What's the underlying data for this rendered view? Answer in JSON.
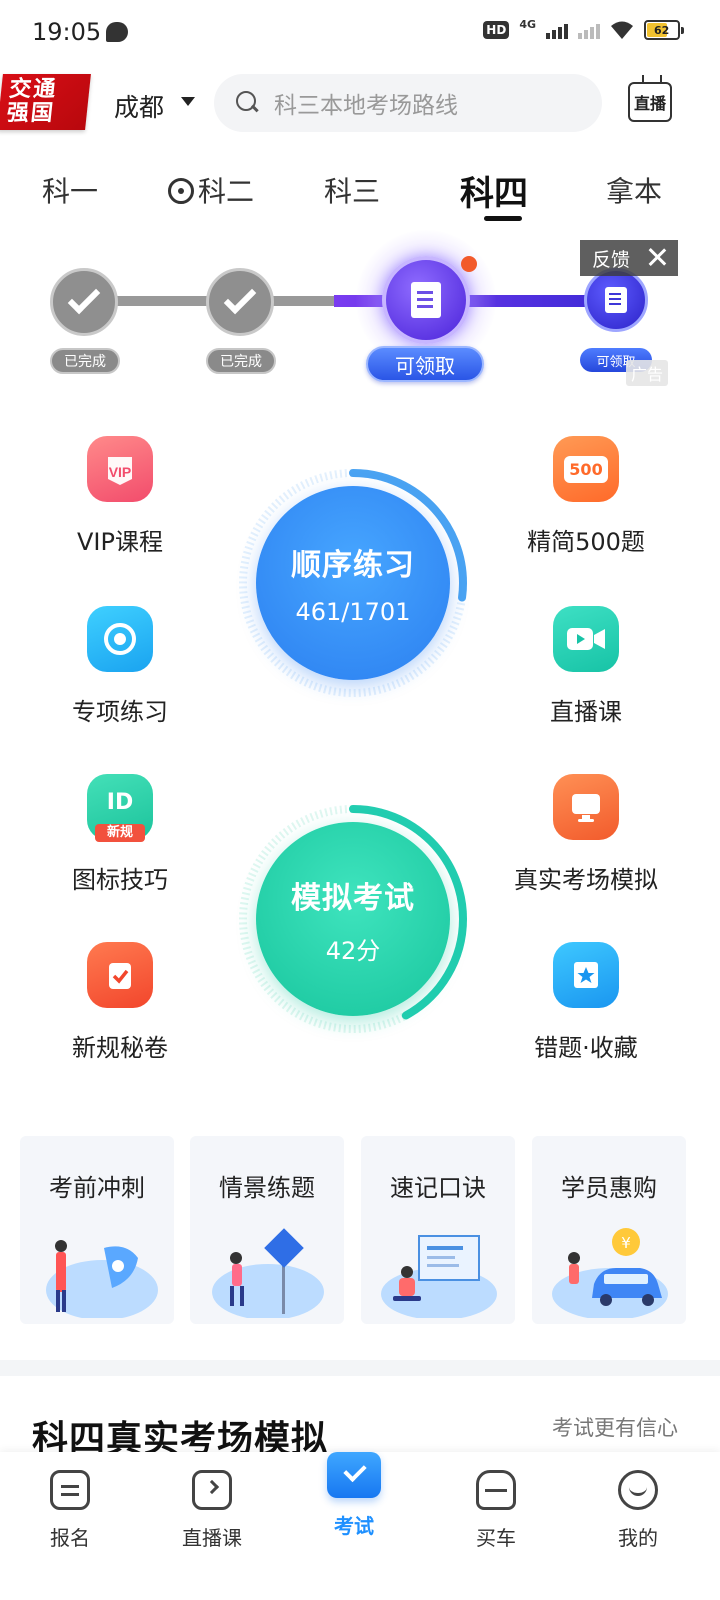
{
  "status": {
    "time": "19:05",
    "network": "4G",
    "battery": "62"
  },
  "header": {
    "logo_line1": "交通",
    "logo_line2": "强国",
    "city": "成都",
    "search_placeholder": "科三本地考场路线",
    "live_label": "直播"
  },
  "tabs": [
    {
      "label": "科一"
    },
    {
      "label": "科二"
    },
    {
      "label": "科三"
    },
    {
      "label": "科四"
    },
    {
      "label": "拿本"
    }
  ],
  "progress": {
    "steps": [
      {
        "label": "已完成"
      },
      {
        "label": "已完成"
      },
      {
        "label": "可领取"
      },
      {
        "label": "可领取"
      }
    ],
    "feedback_label": "反馈",
    "ad_label": "广告"
  },
  "features": {
    "vip": "VIP课程",
    "jingjian": "精简500题",
    "zhuanxiang": "专项练习",
    "live_course": "直播课",
    "tubiao": "图标技巧",
    "zhenshi": "真实考场模拟",
    "xingui": "新规秘卷",
    "cuoti": "错题·收藏",
    "badge_500": "500",
    "badge_new": "新规"
  },
  "practice": {
    "title": "顺序练习",
    "progress_text": "461/1701",
    "done": 461,
    "total": 1701
  },
  "exam": {
    "title": "模拟考试",
    "score_text": "42分",
    "score": 42
  },
  "cards": [
    {
      "title": "考前冲刺"
    },
    {
      "title": "情景练题"
    },
    {
      "title": "速记口诀"
    },
    {
      "title": "学员惠购"
    }
  ],
  "section": {
    "title": "科四真实考场模拟",
    "link": "考试更有信心"
  },
  "nav": [
    {
      "label": "报名"
    },
    {
      "label": "直播课"
    },
    {
      "label": "考试"
    },
    {
      "label": "买车"
    },
    {
      "label": "我的"
    }
  ],
  "colors": {
    "accent": "#1e90ff",
    "practice": "#3a8ff0",
    "exam": "#1fcfae",
    "purple": "#5a30e0"
  }
}
